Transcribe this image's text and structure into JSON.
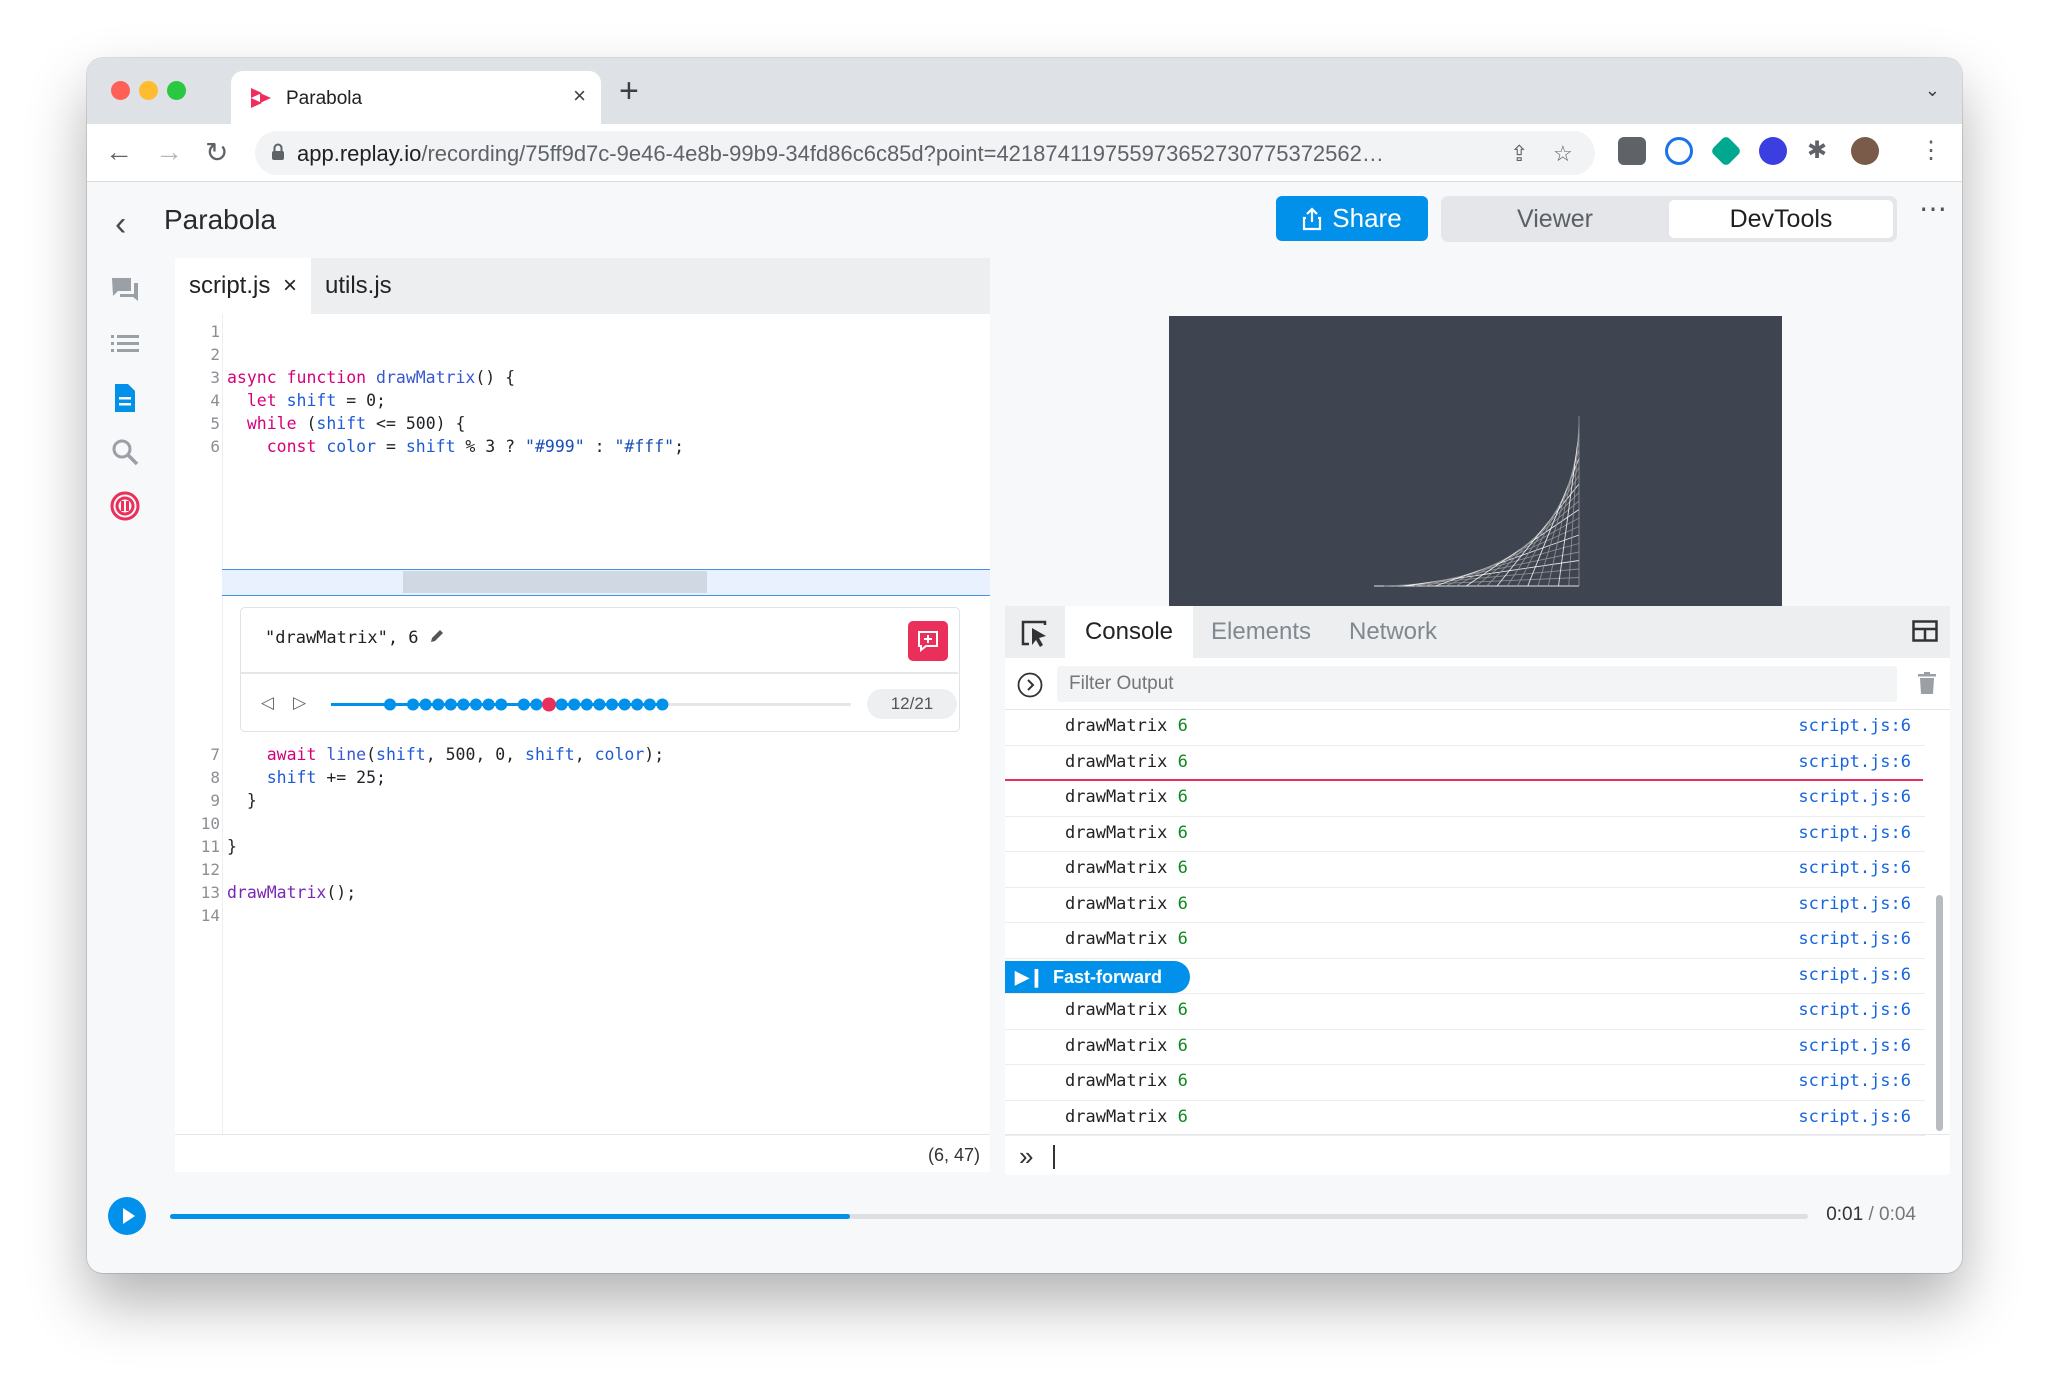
{
  "browser": {
    "tab_title": "Parabola",
    "tab_close": "×",
    "new_tab": "+",
    "url_host": "app.replay.io",
    "url_path": "/recording/75ff9d7c-9e46-4e8b-99b9-34fd86c6c85d?point=421874119755973652730775372562…"
  },
  "app": {
    "page_title": "Parabola",
    "share_label": "Share",
    "mode_viewer": "Viewer",
    "mode_devtools": "DevTools",
    "accent": "#0191eb",
    "breakpoint_color": "#ea2f5b"
  },
  "editor": {
    "tabs": [
      {
        "label": "script.js",
        "close": "×"
      },
      {
        "label": "utils.js"
      }
    ],
    "line_numbers": [
      "1",
      "2",
      "3",
      "4",
      "5",
      "6",
      "7",
      "8",
      "9",
      "10",
      "11",
      "12",
      "13",
      "14"
    ],
    "code": {
      "l3_kw": "async function ",
      "l3_fn": "drawMatrix",
      "l3_rest": "() {",
      "l4_kw": "  let ",
      "l4_var": "shift",
      "l4_rest": " = 0;",
      "l5_kw": "  while ",
      "l5_p1": "(",
      "l5_var": "shift",
      "l5_rest": " <= 500) {",
      "l6_kw": "    const ",
      "l6_var": "color",
      "l6_eq": " = ",
      "l6_shift": "shift",
      "l6_rest": " % 3 ? ",
      "l6_s1": "\"#999\"",
      "l6_colon": " : ",
      "l6_s2": "\"#fff\"",
      "l6_semi": ";",
      "l7_kw": "    await ",
      "l7_fn": "line",
      "l7_p1": "(",
      "l7_a1": "shift",
      "l7_mid": ", 500, 0, ",
      "l7_a2": "shift",
      "l7_comma": ", ",
      "l7_a3": "color",
      "l7_end": ");",
      "l8_var": "    shift",
      "l8_rest": " += 25;",
      "l9": "  }",
      "l11": "}",
      "l13_fn": "drawMatrix",
      "l13_rest": "();"
    },
    "breakpoint": {
      "expression": "\"drawMatrix\", 6",
      "counter": "12/21",
      "hit_index": 12,
      "hit_total": 21
    },
    "cursor_position": "(6, 47)"
  },
  "devtools": {
    "tabs": [
      "Console",
      "Elements",
      "Network"
    ],
    "filter_placeholder": "Filter Output",
    "messages": [
      {
        "text": "drawMatrix",
        "num": "6",
        "source": "script.js:6"
      },
      {
        "text": "drawMatrix",
        "num": "6",
        "source": "script.js:6"
      },
      {
        "text": "drawMatrix",
        "num": "6",
        "source": "script.js:6"
      },
      {
        "text": "drawMatrix",
        "num": "6",
        "source": "script.js:6"
      },
      {
        "text": "drawMatrix",
        "num": "6",
        "source": "script.js:6"
      },
      {
        "text": "drawMatrix",
        "num": "6",
        "source": "script.js:6"
      },
      {
        "text": "drawMatrix",
        "num": "6",
        "source": "script.js:6"
      },
      {
        "fast_forward": "Fast-forward",
        "source": "script.js:6"
      },
      {
        "text": "drawMatrix",
        "num": "6",
        "source": "script.js:6"
      },
      {
        "text": "drawMatrix",
        "num": "6",
        "source": "script.js:6"
      },
      {
        "text": "drawMatrix",
        "num": "6",
        "source": "script.js:6"
      },
      {
        "text": "drawMatrix",
        "num": "6",
        "source": "script.js:6"
      }
    ],
    "prompt": "»"
  },
  "timeline": {
    "current": "0:01",
    "separator": " / ",
    "total": "0:04",
    "progress": 0.415
  }
}
